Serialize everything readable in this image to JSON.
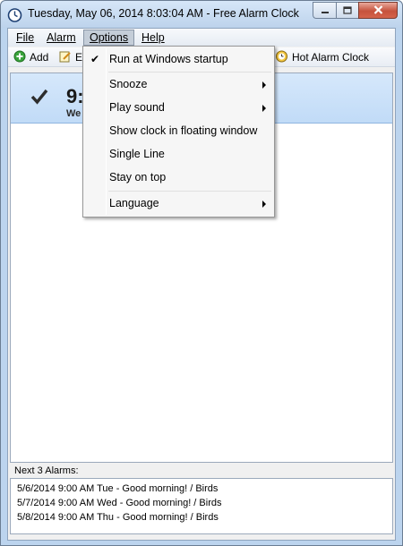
{
  "window": {
    "title": "Tuesday, May 06, 2014 8:03:04 AM - Free Alarm Clock",
    "icon": "alarm-clock-icon"
  },
  "menubar": {
    "file": "File",
    "alarm": "Alarm",
    "options": "Options",
    "help": "Help"
  },
  "toolbar": {
    "add_label": "Add",
    "edit_label": "E",
    "hot_alarm_label": "Hot Alarm Clock"
  },
  "alarm_list": {
    "items": [
      {
        "checked": true,
        "time": "9:",
        "days": "We"
      }
    ]
  },
  "next_alarms": {
    "label": "Next 3 Alarms:",
    "items": [
      "5/6/2014 9:00 AM Tue - Good morning! / Birds",
      "5/7/2014 9:00 AM Wed - Good morning! / Birds",
      "5/8/2014 9:00 AM Thu - Good morning! / Birds"
    ]
  },
  "options_menu": {
    "items": [
      {
        "label": "Run at Windows startup",
        "checked": true,
        "submenu": false
      },
      {
        "label": "Snooze",
        "checked": false,
        "submenu": true
      },
      {
        "label": "Play sound",
        "checked": false,
        "submenu": true
      },
      {
        "label": "Show clock in floating window",
        "checked": false,
        "submenu": false
      },
      {
        "label": "Single Line",
        "checked": false,
        "submenu": false
      },
      {
        "label": "Stay on top",
        "checked": false,
        "submenu": false
      },
      {
        "label": "Language",
        "checked": false,
        "submenu": true
      }
    ]
  },
  "colors": {
    "title_bar": "#bdd3ec",
    "selected_row": "#c1dbf7",
    "close_button": "#c6523c"
  }
}
